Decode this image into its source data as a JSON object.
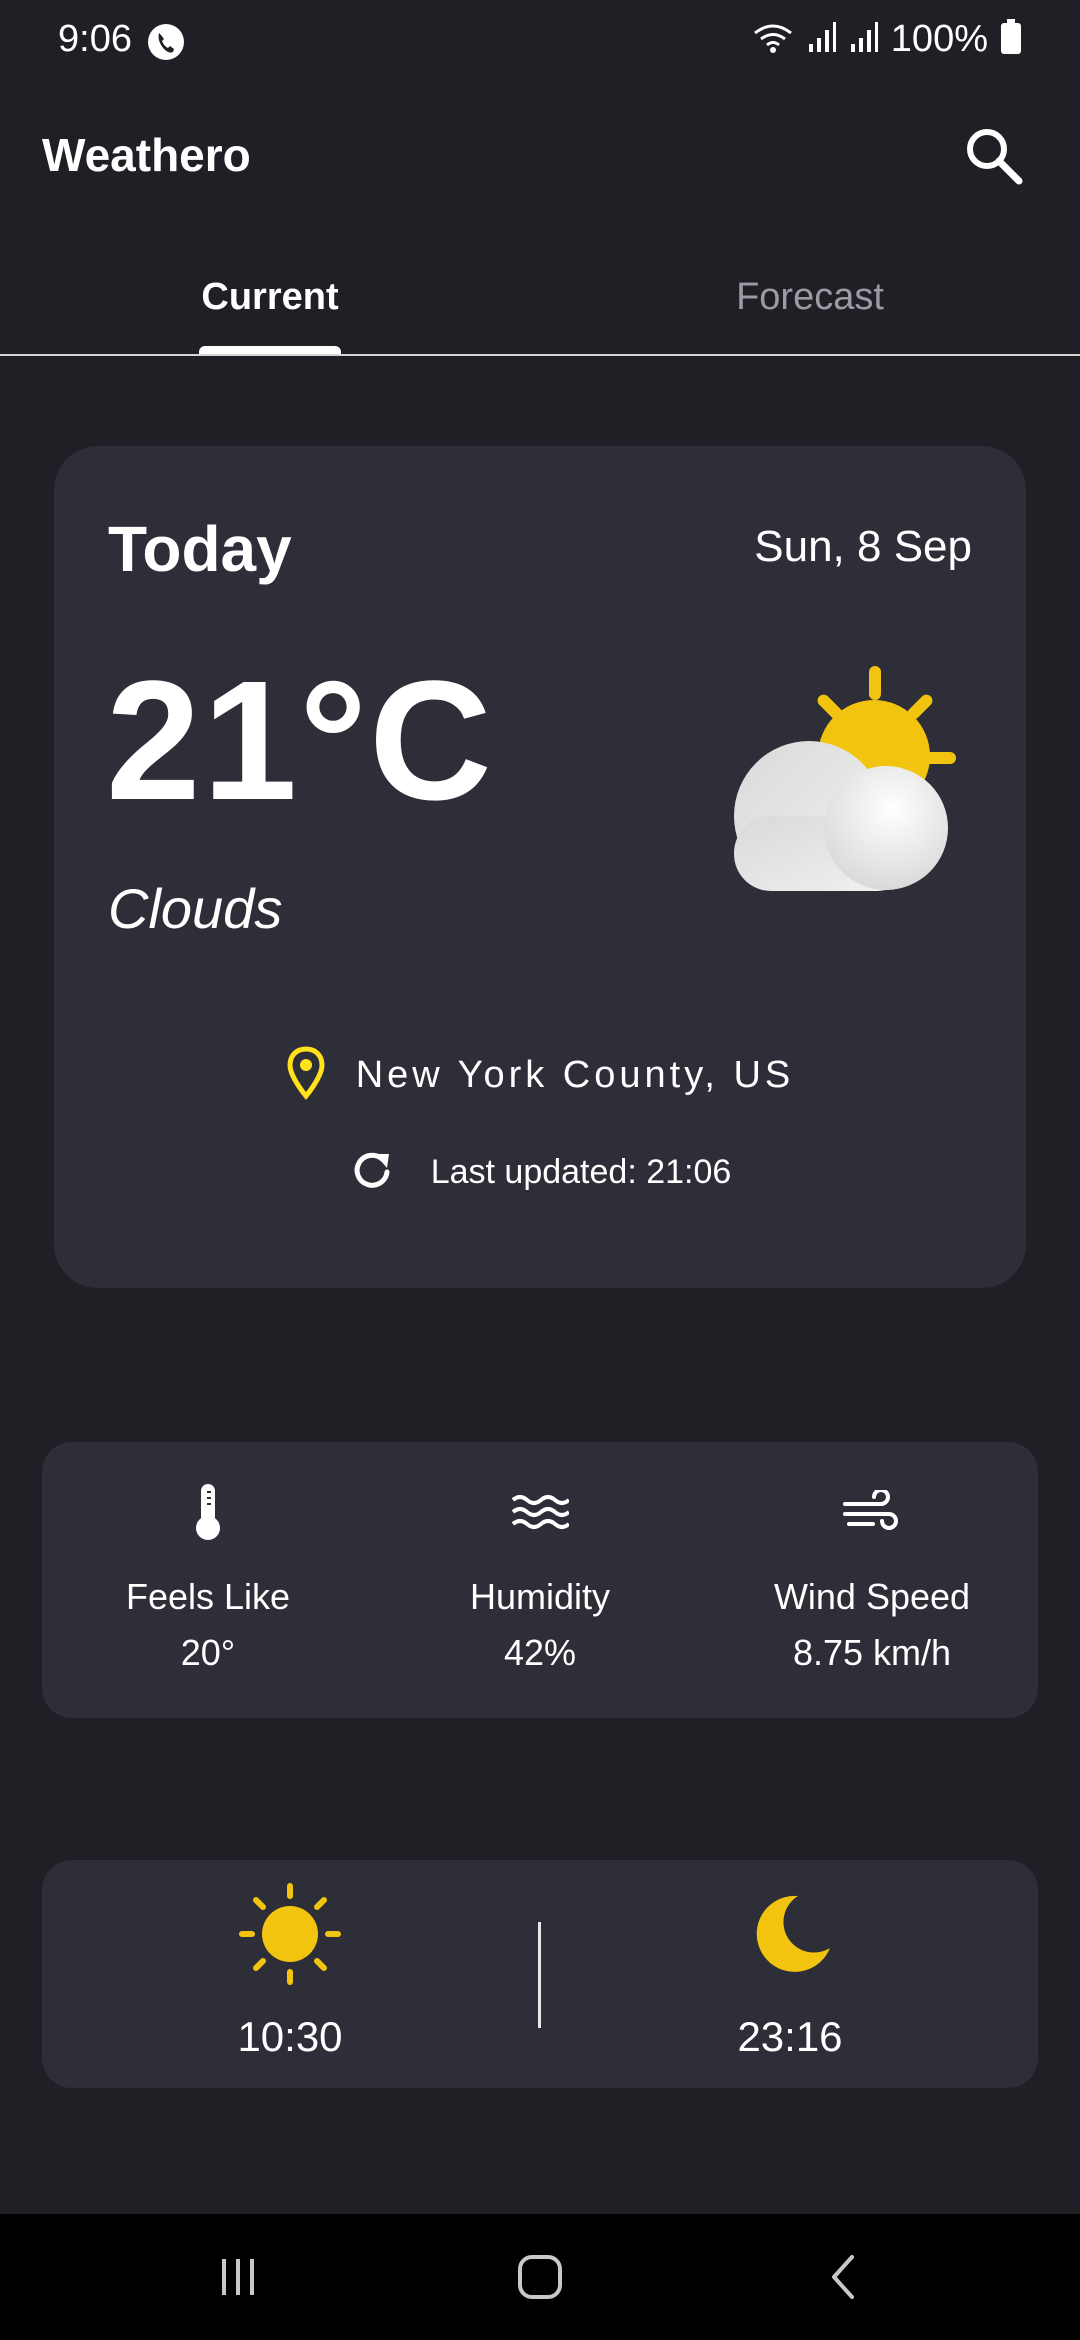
{
  "status_bar": {
    "time": "9:06",
    "battery": "100%"
  },
  "app": {
    "title": "Weathero"
  },
  "tabs": [
    {
      "label": "Current",
      "selected": true
    },
    {
      "label": "Forecast",
      "selected": false
    }
  ],
  "current": {
    "day_label": "Today",
    "date": "Sun, 8 Sep",
    "temperature": "21°C",
    "condition": "Clouds",
    "icon": "partly-cloudy-icon",
    "location": "New York County, US",
    "last_updated": "Last updated: 21:06"
  },
  "stats": [
    {
      "icon": "thermometer-icon",
      "label": "Feels Like",
      "value": "20°"
    },
    {
      "icon": "humidity-waves-icon",
      "label": "Humidity",
      "value": "42%"
    },
    {
      "icon": "wind-icon",
      "label": "Wind Speed",
      "value": "8.75 km/h"
    }
  ],
  "sun": {
    "sunrise": "10:30",
    "sunset": "23:16"
  },
  "colors": {
    "background": "#1f2026",
    "card": "#2d2e38",
    "accent_yellow": "#f2c40f",
    "location_pin": "#ffe21a"
  }
}
